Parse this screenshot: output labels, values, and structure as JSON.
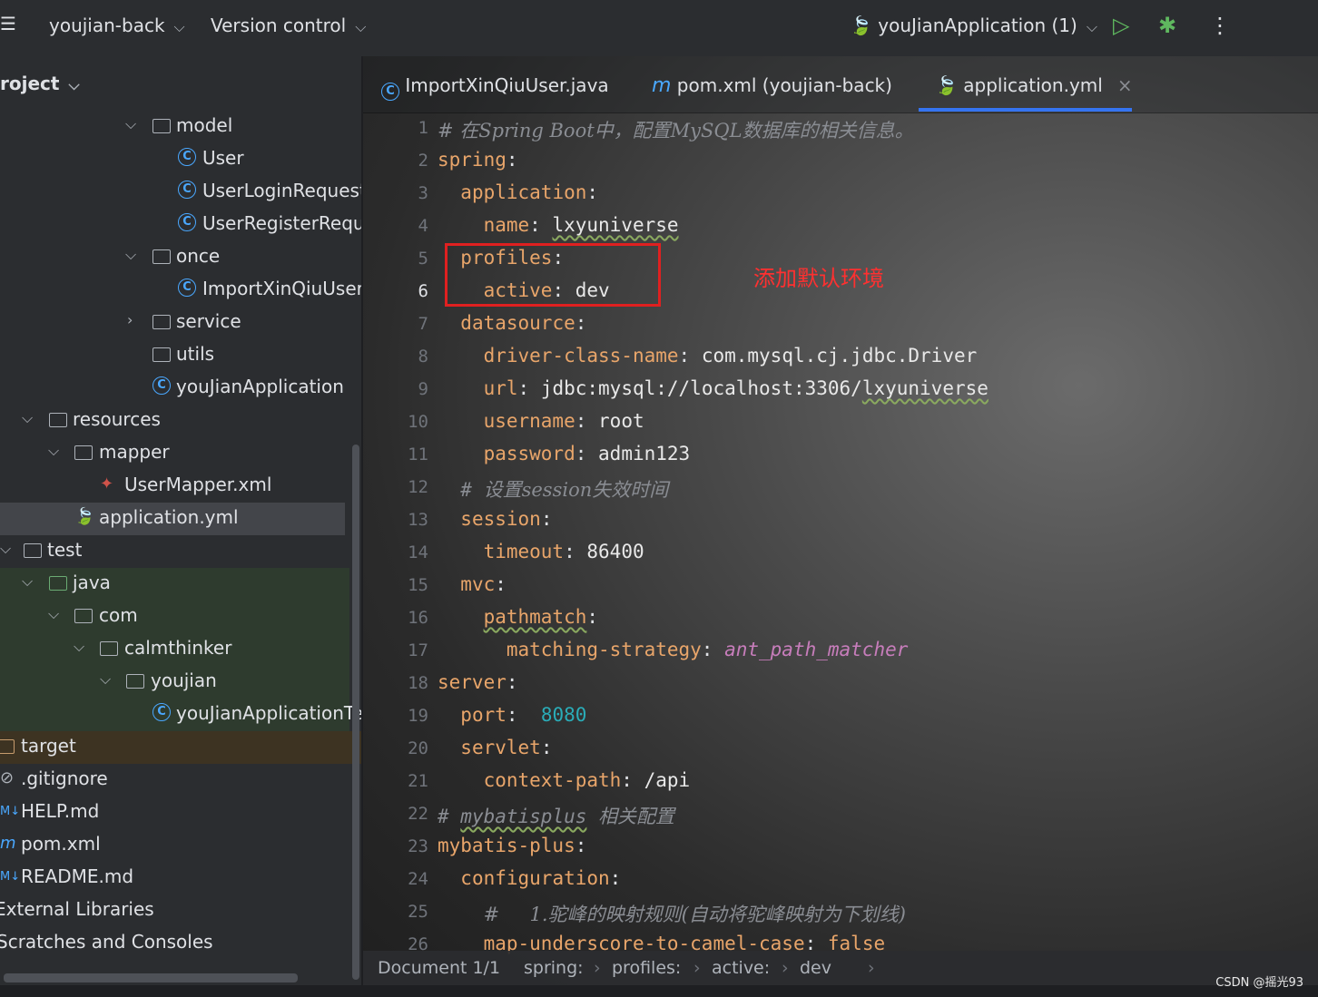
{
  "toolbar": {
    "project_name": "youjian-back",
    "vcs": "Version control",
    "run_config": "youJianApplication (1)"
  },
  "sidebar": {
    "header": "roject",
    "rows": [
      {
        "label": "model",
        "kind": "folder"
      },
      {
        "label": "User",
        "kind": "class"
      },
      {
        "label": "UserLoginRequest",
        "kind": "class"
      },
      {
        "label": "UserRegisterReque",
        "kind": "class"
      },
      {
        "label": "once",
        "kind": "folder"
      },
      {
        "label": "ImportXinQiuUser",
        "kind": "class"
      },
      {
        "label": "service",
        "kind": "folder"
      },
      {
        "label": "utils",
        "kind": "folder"
      },
      {
        "label": "youJianApplication",
        "kind": "spring-class"
      },
      {
        "label": "resources",
        "kind": "folder"
      },
      {
        "label": "mapper",
        "kind": "folder"
      },
      {
        "label": "UserMapper.xml",
        "kind": "xml"
      },
      {
        "label": "application.yml",
        "kind": "yml"
      },
      {
        "label": "test",
        "kind": "folder"
      },
      {
        "label": "java",
        "kind": "folder"
      },
      {
        "label": "com",
        "kind": "folder"
      },
      {
        "label": "calmthinker",
        "kind": "folder"
      },
      {
        "label": "youjian",
        "kind": "folder"
      },
      {
        "label": "youJianApplicationTes",
        "kind": "class"
      },
      {
        "label": "target",
        "kind": "folder"
      },
      {
        "label": ".gitignore",
        "kind": "ignore"
      },
      {
        "label": "HELP.md",
        "kind": "md"
      },
      {
        "label": "pom.xml",
        "kind": "maven"
      },
      {
        "label": "README.md",
        "kind": "md"
      },
      {
        "label": "External Libraries",
        "kind": "lib"
      },
      {
        "label": "Scratches and Consoles",
        "kind": "scratch"
      }
    ]
  },
  "tabs": [
    {
      "label": "ImportXinQiuUser.java"
    },
    {
      "label": "pom.xml (youjian-back)"
    },
    {
      "label": "application.yml"
    }
  ],
  "editor": {
    "line_numbers": [
      "1",
      "2",
      "3",
      "4",
      "5",
      "6",
      "7",
      "8",
      "9",
      "10",
      "11",
      "12",
      "13",
      "14",
      "15",
      "16",
      "17",
      "18",
      "19",
      "20",
      "21",
      "22",
      "23",
      "24",
      "25",
      "26"
    ],
    "annotation": "添加默认环境",
    "lines": {
      "l1": "# 在Spring Boot中，配置MySQL数据库的相关信息。",
      "l2k": "spring",
      "l3k": "application",
      "l4k": "name",
      "l4v": "lxyuniverse",
      "l5k": "profiles",
      "l6k": "active",
      "l6v": "dev",
      "l7k": "datasource",
      "l8k": "driver-class-name",
      "l8v": "com.mysql.cj.jdbc.Driver",
      "l9k": "url",
      "l9v1": "jdbc:mysql://localhost:3306/",
      "l9v2": "lxyuniverse",
      "l10k": "username",
      "l10v": "root",
      "l11k": "password",
      "l11v": "admin123",
      "l12c1": "# ",
      "l12c2": "设置session失效时间",
      "l13k": "session",
      "l14k": "timeout",
      "l14v": "86400",
      "l15k": "mvc",
      "l16k": "pathmatch",
      "l17k": "matching-strategy",
      "l17v": "ant_path_matcher",
      "l18k": "server",
      "l19k": "port",
      "l19v": "8080",
      "l20k": "servlet",
      "l21k": "context-path",
      "l21v": "/api",
      "l22c1": "# ",
      "l22c2": "mybatisplus",
      "l22c3": "相关配置",
      "l23k": "mybatis-plus",
      "l24k": "configuration",
      "l25c": "#     1.驼峰的映射规则(自动将驼峰映射为下划线)",
      "l26k": "map-underscore-to-camel-case",
      "l26v": "false"
    }
  },
  "statusbar": {
    "crumbs": [
      "Document 1/1",
      "spring:",
      "profiles:",
      "active:",
      "dev"
    ]
  },
  "watermark": "CSDN @摇光93"
}
